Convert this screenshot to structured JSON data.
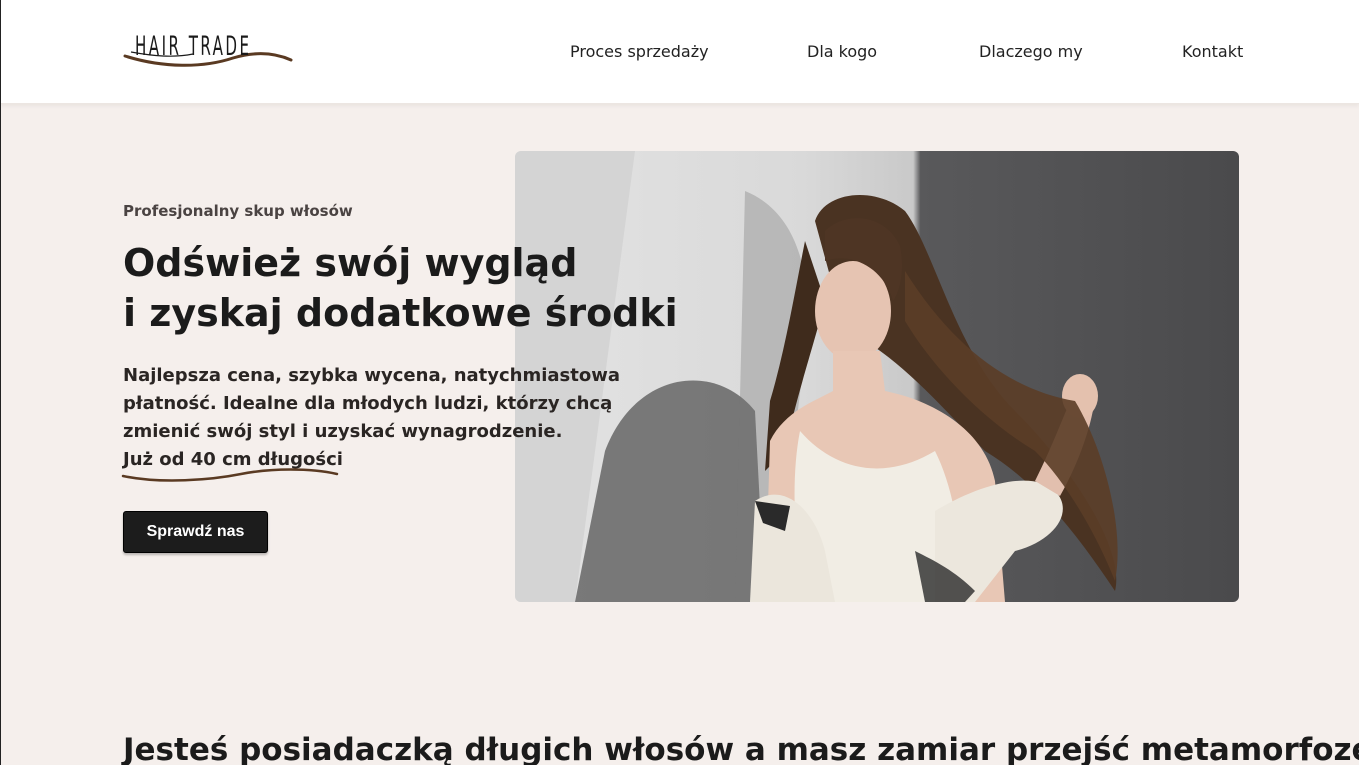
{
  "brand": {
    "logo_text": "HAIR TRADE"
  },
  "nav": {
    "items": [
      {
        "label": "Proces sprzedaży"
      },
      {
        "label": "Dla kogo"
      },
      {
        "label": "Dlaczego my"
      },
      {
        "label": "Kontakt"
      }
    ]
  },
  "hero": {
    "eyebrow": "Profesjonalny skup włosów",
    "title_lines": [
      "Odśwież swój wygląd",
      "i zyskaj dodatkowe środki"
    ],
    "description_lines": [
      "Najlepsza cena, szybka wycena, natychmiastowa",
      "płatność. Idealne dla młodych ludzi, którzy chcą",
      "zmienić swój styl i uzyskać wynagrodzenie.",
      "Już od 40 cm długości"
    ],
    "cta_label": "Sprawdź nas",
    "photo_icon": "woman-with-long-hair-photo"
  },
  "section2": {
    "title": "Jesteś posiadaczką długich włosów a masz zamiar przejść metamorfozę?"
  },
  "colors": {
    "background": "#f5efec",
    "header": "#ffffff",
    "accent_brown": "#5a3a22",
    "cta": "#1c1c1c"
  }
}
